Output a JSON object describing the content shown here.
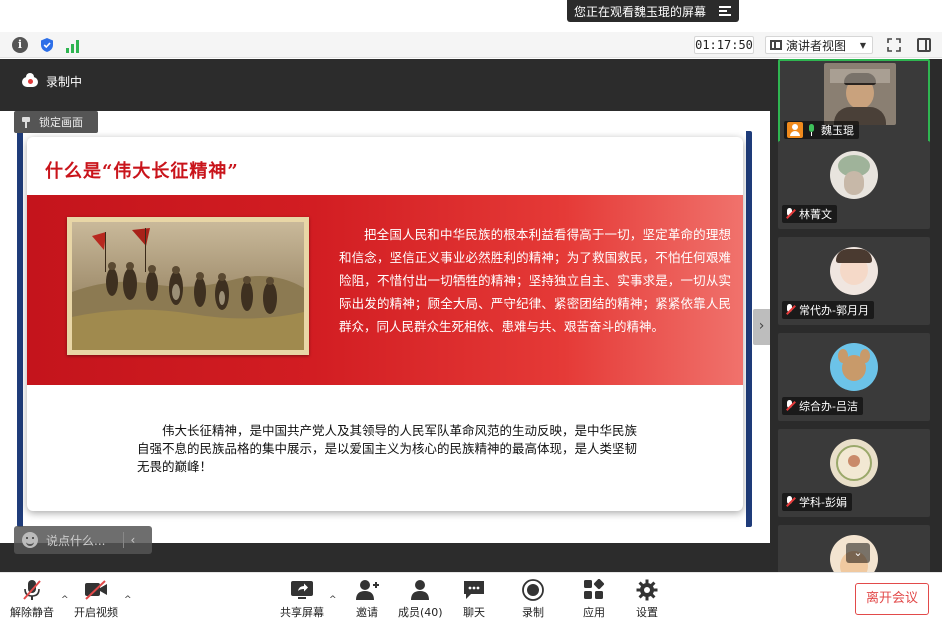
{
  "banner": {
    "text": "您正在观看魏玉琨的屏幕"
  },
  "statusbar": {
    "timer": "01:17:50",
    "view_mode": "演讲者视图"
  },
  "recording": {
    "label": "录制中",
    "lock_label": "锁定画面"
  },
  "slide": {
    "title": "什么是“伟大长征精神”",
    "band_text": "把全国人民和中华民族的根本利益看得高于一切，坚定革命的理想和信念，坚信正义事业必然胜利的精神；为了救国救民，不怕任何艰难险阻，不惜付出一切牺牲的精神；坚持独立自主、实事求是，一切从实际出发的精神；顾全大局、严守纪律、紧密团结的精神；紧紧依靠人民群众，同人民群众生死相依、患难与共、艰苦奋斗的精神。",
    "bottom_text": "伟大长征精神，是中国共产党人及其领导的人民军队革命风范的生动反映，是中华民族自强不息的民族品格的集中展示，是以爱国主义为核心的民族精神的最高体现，是人类坚韧无畏的巅峰！"
  },
  "chat": {
    "placeholder": "说点什么..."
  },
  "participants": [
    {
      "name": "魏玉琨",
      "mic": "active",
      "host": true
    },
    {
      "name": "林菁文",
      "mic": "muted"
    },
    {
      "name": "常代办-郭月月",
      "mic": "muted"
    },
    {
      "name": "综合办-吕洁",
      "mic": "muted"
    },
    {
      "name": "学科-彭娟",
      "mic": "muted"
    }
  ],
  "toolbar": {
    "unmute": "解除静音",
    "video": "开启视频",
    "share": "共享屏幕",
    "invite": "邀请",
    "members": "成员(40)",
    "chat": "聊天",
    "record": "录制",
    "apps": "应用",
    "settings": "设置",
    "leave": "离开会议"
  },
  "colors": {
    "accent_red": "#c9141b",
    "active_green": "#2fb551",
    "leave_red": "#e24a4a"
  }
}
